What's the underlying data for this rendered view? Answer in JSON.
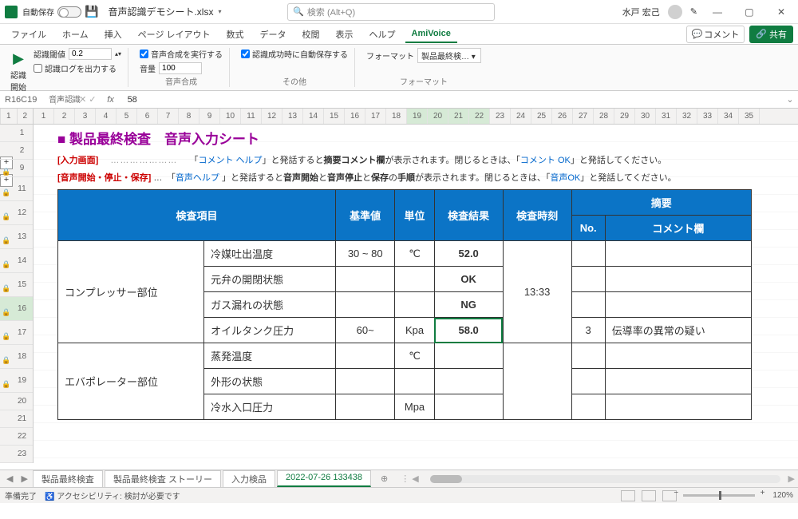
{
  "titlebar": {
    "autosave_label": "自動保存",
    "autosave_state": "オフ",
    "doc_name": "音声認識デモシート.xlsx",
    "search_placeholder": "検索 (Alt+Q)",
    "user_name": "水戸 宏己"
  },
  "ribbon": {
    "tabs": [
      "ファイル",
      "ホーム",
      "挿入",
      "ページ レイアウト",
      "数式",
      "データ",
      "校閲",
      "表示",
      "ヘルプ",
      "AmiVoice"
    ],
    "active_tab": 9,
    "comment_btn": "コメント",
    "share_btn": "共有",
    "groups": {
      "voice_rec": {
        "play_label": "認識\n開始",
        "threshold_label": "認識閾値",
        "threshold_value": "0.2",
        "log_checkbox": "認識ログを出力する",
        "group_name": "音声認識"
      },
      "synth": {
        "run_checkbox": "音声合成を実行する",
        "volume_label": "音量",
        "volume_value": "100",
        "group_name": "音声合成"
      },
      "other": {
        "autosave_success": "認識成功時に自動保存する",
        "group_name": "その他"
      },
      "format": {
        "format_label": "フォーマット",
        "format_value": "製品最終検…",
        "group_name": "フォーマット"
      }
    }
  },
  "formula": {
    "namebox": "R16C19",
    "value": "58"
  },
  "column_groups": [
    "1",
    "2"
  ],
  "columns": [
    "1",
    "2",
    "3",
    "4",
    "5",
    "6",
    "7",
    "8",
    "9",
    "10",
    "11",
    "12",
    "13",
    "14",
    "15",
    "16",
    "17",
    "18",
    "19",
    "20",
    "21",
    "22",
    "23",
    "24",
    "25",
    "26",
    "27",
    "28",
    "29",
    "30",
    "31",
    "32",
    "33",
    "34",
    "35"
  ],
  "selected_cols": [
    19,
    20,
    21,
    22
  ],
  "rows": [
    {
      "n": "1"
    },
    {
      "n": "2"
    },
    {
      "n": "9",
      "lock": true
    },
    {
      "n": "11",
      "lock": true,
      "tall": true
    },
    {
      "n": "12",
      "lock": true,
      "tall": true
    },
    {
      "n": "13",
      "lock": true,
      "tall": true
    },
    {
      "n": "14",
      "lock": true,
      "tall": true
    },
    {
      "n": "15",
      "lock": true,
      "tall": true
    },
    {
      "n": "16",
      "lock": true,
      "tall": true,
      "sel": true
    },
    {
      "n": "17",
      "lock": true,
      "tall": true
    },
    {
      "n": "18",
      "lock": true,
      "tall": true
    },
    {
      "n": "19",
      "lock": true,
      "tall": true
    },
    {
      "n": "20"
    },
    {
      "n": "21"
    },
    {
      "n": "22"
    },
    {
      "n": "23"
    }
  ],
  "sheet": {
    "title": "■ 製品最終検査　音声入力シート",
    "note1": {
      "label": "[入力画面]",
      "pre": "「",
      "help": "コメント ヘルプ",
      "mid1": "」と発話すると",
      "bold1": "摘要コメント欄",
      "mid2": "が表示されます。閉じるときは、「",
      "ok": "コメント OK",
      "post": "」と発話してください。"
    },
    "note2": {
      "label": "[音声開始・停止・保存]",
      "pre": "…　「",
      "help": "音声ヘルプ ",
      "mid1": "」と発話すると",
      "b1": "音声開始",
      "and1": "と",
      "b2": "音声停止",
      "and2": "と",
      "b3": "保存",
      "of": "の",
      "b4": "手順",
      "mid2": "が表示されます。閉じるときは、「",
      "ok": "音声OK",
      "post": "」と発話してください。"
    },
    "headers": {
      "item": "検査項目",
      "std": "基準値",
      "unit": "単位",
      "result": "検査結果",
      "time": "検査時刻",
      "summary": "摘要",
      "no": "No.",
      "comment": "コメント欄"
    },
    "rows": [
      {
        "group": "コンプレッサー部位",
        "item": "冷媒吐出温度",
        "std": "30 ~ 80",
        "unit": "℃",
        "result": "52.0",
        "time": "13:33",
        "no": "",
        "comment": ""
      },
      {
        "group": "",
        "item": "元弁の開閉状態",
        "std": "",
        "unit": "",
        "result": "OK",
        "time": "",
        "no": "",
        "comment": ""
      },
      {
        "group": "",
        "item": "ガス漏れの状態",
        "std": "",
        "unit": "",
        "result": "NG",
        "time": "",
        "no": "",
        "comment": ""
      },
      {
        "group": "",
        "item": "オイルタンク圧力",
        "std": "60~",
        "unit": "Kpa",
        "result": "58.0",
        "time": "",
        "no": "3",
        "comment": "伝導率の異常の疑い"
      },
      {
        "group": "エバポレーター部位",
        "item": "蒸発温度",
        "std": "",
        "unit": "℃",
        "result": "",
        "time": "",
        "no": "",
        "comment": ""
      },
      {
        "group": "",
        "item": "外形の状態",
        "std": "",
        "unit": "",
        "result": "",
        "time": "",
        "no": "",
        "comment": ""
      },
      {
        "group": "",
        "item": "冷水入口圧力",
        "std": "",
        "unit": "Mpa",
        "result": "",
        "time": "",
        "no": "",
        "comment": ""
      }
    ]
  },
  "sheet_tabs": [
    "製品最終検査",
    "製品最終検査 ストーリー",
    "入力検品",
    "2022-07-26 133438"
  ],
  "sheet_tab_active": 3,
  "statusbar": {
    "ready": "準備完了",
    "accessibility_icon": "♿",
    "accessibility": "アクセシビリティ: 検討が必要です",
    "zoom": "120%"
  }
}
